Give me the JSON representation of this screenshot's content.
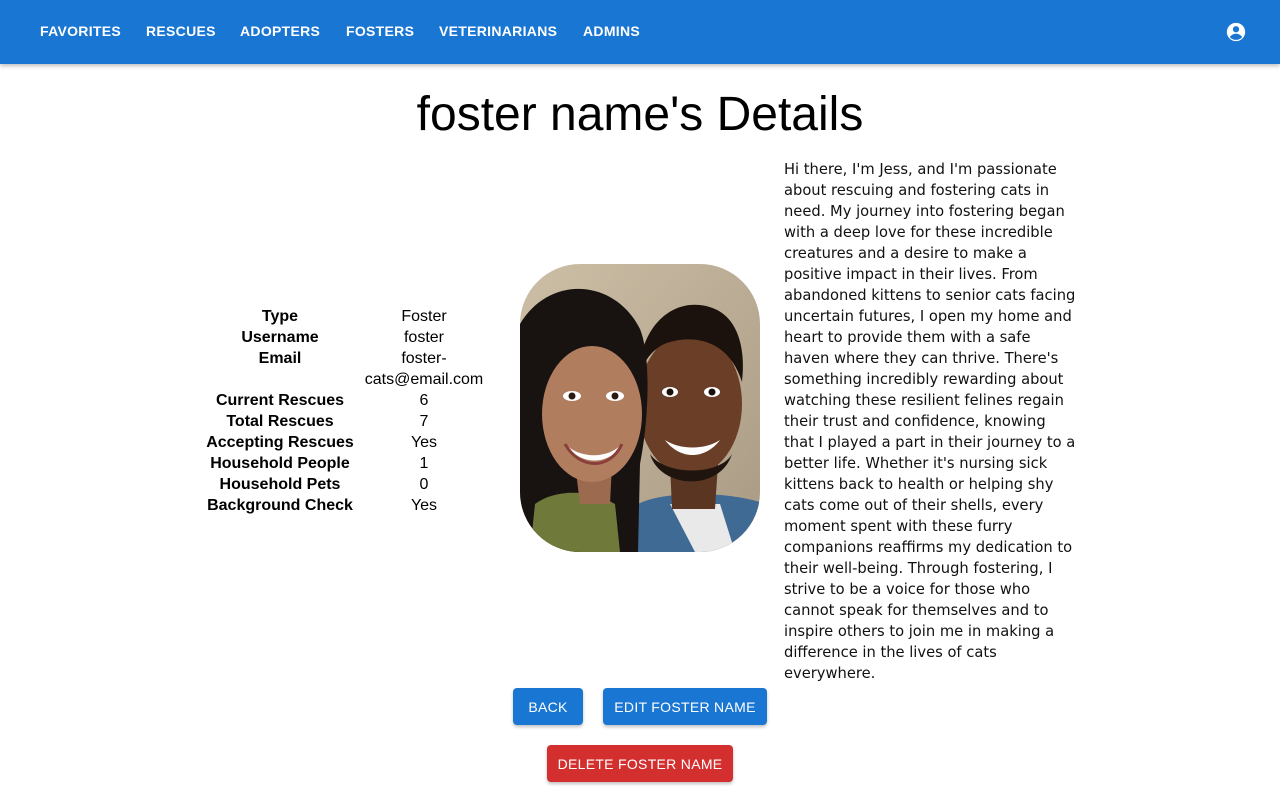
{
  "nav": {
    "items": [
      "FAVORITES",
      "RESCUES",
      "ADOPTERS",
      "FOSTERS",
      "VETERINARIANS",
      "ADMINS"
    ]
  },
  "page": {
    "title": "foster name's Details"
  },
  "details": {
    "type_label": "Type",
    "type_value": "Foster",
    "username_label": "Username",
    "username_value": "foster",
    "email_label": "Email",
    "email_value_1": "foster-",
    "email_value_2": "cats@email.com",
    "current_rescues_label": "Current Rescues",
    "current_rescues_value": "6",
    "total_rescues_label": "Total Rescues",
    "total_rescues_value": "7",
    "accepting_rescues_label": "Accepting Rescues",
    "accepting_rescues_value": "Yes",
    "household_people_label": "Household People",
    "household_people_value": "1",
    "household_pets_label": "Household Pets",
    "household_pets_value": "0",
    "background_check_label": "Background Check",
    "background_check_value": "Yes"
  },
  "bio": {
    "text": "Hi there, I'm Jess, and I'm passionate about rescuing and fostering cats in need. My journey into fostering began with a deep love for these incredible creatures and a desire to make a positive impact in their lives. From abandoned kittens to senior cats facing uncertain futures, I open my home and heart to provide them with a safe haven where they can thrive. There's something incredibly rewarding about watching these resilient felines regain their trust and confidence, knowing that I played a part in their journey to a better life. Whether it's nursing sick kittens back to health or helping shy cats come out of their shells, every moment spent with these furry companions reaffirms my dedication to their well-being. Through fostering, I strive to be a voice for those who cannot speak for themselves and to inspire others to join me in making a difference in the lives of cats everywhere."
  },
  "actions": {
    "back_label": "BACK",
    "edit_label": "EDIT FOSTER NAME",
    "delete_label": "DELETE FOSTER NAME"
  },
  "icons": {
    "account": "account-circle-icon"
  },
  "colors": {
    "primary": "#1976d2",
    "danger": "#d32f2f"
  }
}
